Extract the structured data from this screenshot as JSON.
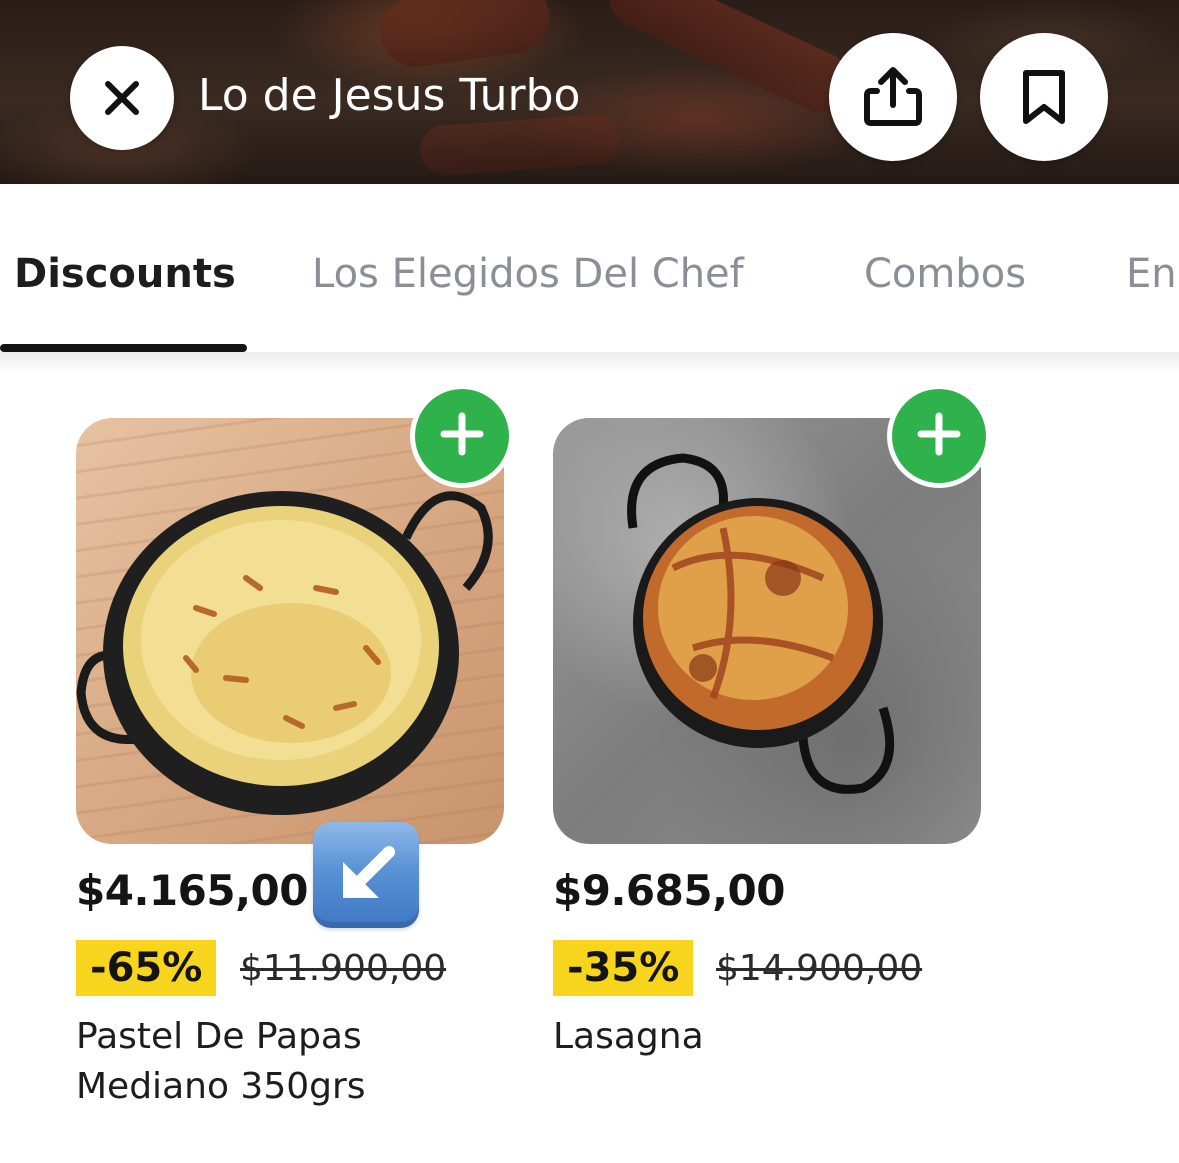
{
  "header": {
    "store_name": "Lo de Jesus Turbo",
    "close_icon": "close-icon",
    "share_icon": "share-icon",
    "bookmark_icon": "bookmark-icon"
  },
  "tabs": [
    {
      "label": "Discounts",
      "active": true
    },
    {
      "label": "Los Elegidos Del Chef",
      "active": false
    },
    {
      "label": "Combos",
      "active": false
    },
    {
      "label": "En",
      "active": false
    }
  ],
  "products": [
    {
      "price": "$4.165,00",
      "discount": "-65%",
      "original_price": "$11.900,00",
      "name": "Pastel De Papas Mediano 350grs",
      "add_icon": "plus-icon"
    },
    {
      "price": "$9.685,00",
      "discount": "-35%",
      "original_price": "$14.900,00",
      "name": "Lasagna",
      "add_icon": "plus-icon"
    }
  ],
  "overlay": {
    "icon": "down-left-arrow-emoji-icon"
  },
  "colors": {
    "accent_green": "#2fb24c",
    "discount_yellow": "#f7d51d",
    "text_dark": "#141414",
    "tab_inactive": "#8a8f97"
  }
}
